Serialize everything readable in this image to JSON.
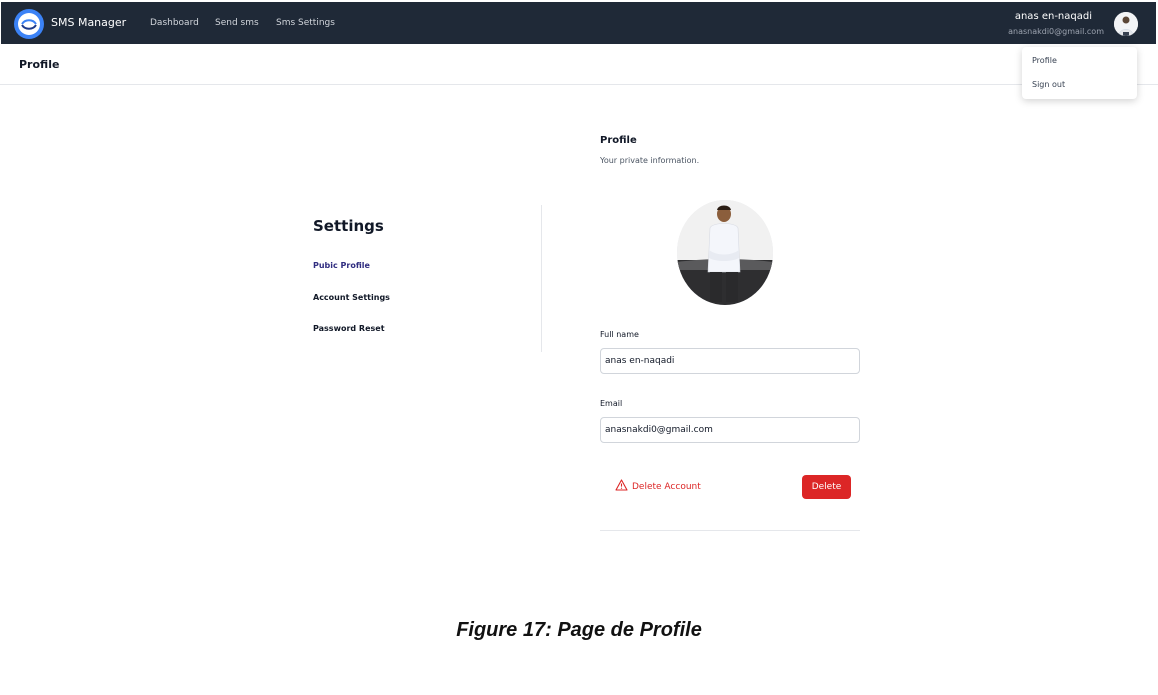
{
  "app": {
    "brand": "SMS Manager",
    "nav": [
      "Dashboard",
      "Send sms",
      "Sms Settings"
    ]
  },
  "user": {
    "name": "anas en-naqadi",
    "email": "anasnakdi0@gmail.com"
  },
  "dropdown": {
    "items": [
      "Profile",
      "Sign out"
    ]
  },
  "page": {
    "title": "Profile"
  },
  "settings": {
    "title": "Settings",
    "links": [
      "Pubic Profile",
      "Account Settings",
      "Password Reset"
    ]
  },
  "profile": {
    "title": "Profile",
    "subtitle": "Your private information.",
    "full_name_label": "Full name",
    "full_name_value": "anas en-naqadi",
    "email_label": "Email",
    "email_value": "anasnakdi0@gmail.com",
    "delete_account_label": "Delete Account",
    "delete_button_label": "Delete"
  },
  "caption": "Figure 17: Page de Profile",
  "colors": {
    "navbar": "#1f2937",
    "accent": "#3b82f6",
    "danger": "#dc2626",
    "active_link": "#312e81"
  },
  "icons": [
    "app-logo-icon",
    "user-avatar",
    "warning-icon"
  ]
}
